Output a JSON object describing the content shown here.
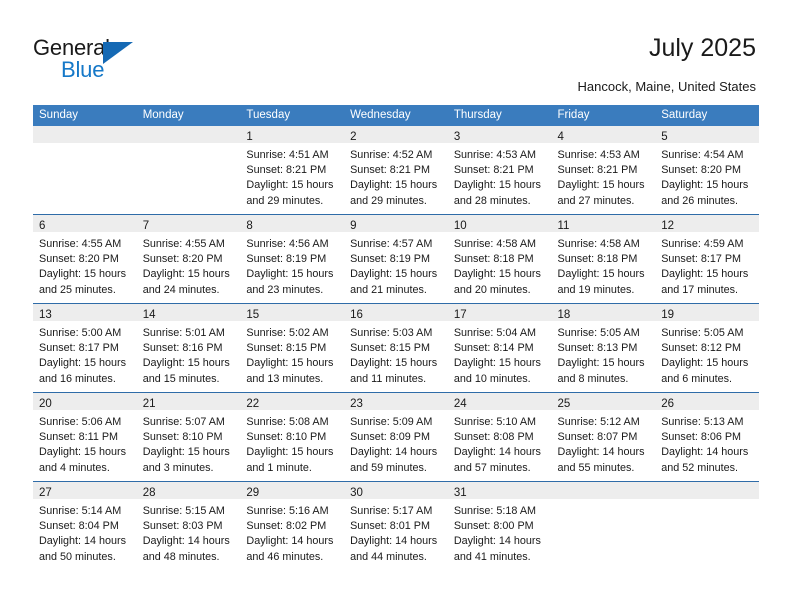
{
  "branding": {
    "name_part1": "General",
    "name_part2": "Blue"
  },
  "header": {
    "title": "July 2025",
    "location": "Hancock, Maine, United States"
  },
  "colors": {
    "header_blue": "#3a7cbe",
    "row_divider_blue": "#2f6ca8",
    "daynum_strip_gray": "#ededed",
    "logo_blue": "#1578c8"
  },
  "weekdays": [
    "Sunday",
    "Monday",
    "Tuesday",
    "Wednesday",
    "Thursday",
    "Friday",
    "Saturday"
  ],
  "weeks": [
    [
      {
        "day": "",
        "sunrise": "",
        "sunset": "",
        "daylight": "",
        "empty": true
      },
      {
        "day": "",
        "sunrise": "",
        "sunset": "",
        "daylight": "",
        "empty": true
      },
      {
        "day": "1",
        "sunrise": "Sunrise: 4:51 AM",
        "sunset": "Sunset: 8:21 PM",
        "daylight": "Daylight: 15 hours and 29 minutes."
      },
      {
        "day": "2",
        "sunrise": "Sunrise: 4:52 AM",
        "sunset": "Sunset: 8:21 PM",
        "daylight": "Daylight: 15 hours and 29 minutes."
      },
      {
        "day": "3",
        "sunrise": "Sunrise: 4:53 AM",
        "sunset": "Sunset: 8:21 PM",
        "daylight": "Daylight: 15 hours and 28 minutes."
      },
      {
        "day": "4",
        "sunrise": "Sunrise: 4:53 AM",
        "sunset": "Sunset: 8:21 PM",
        "daylight": "Daylight: 15 hours and 27 minutes."
      },
      {
        "day": "5",
        "sunrise": "Sunrise: 4:54 AM",
        "sunset": "Sunset: 8:20 PM",
        "daylight": "Daylight: 15 hours and 26 minutes."
      }
    ],
    [
      {
        "day": "6",
        "sunrise": "Sunrise: 4:55 AM",
        "sunset": "Sunset: 8:20 PM",
        "daylight": "Daylight: 15 hours and 25 minutes."
      },
      {
        "day": "7",
        "sunrise": "Sunrise: 4:55 AM",
        "sunset": "Sunset: 8:20 PM",
        "daylight": "Daylight: 15 hours and 24 minutes."
      },
      {
        "day": "8",
        "sunrise": "Sunrise: 4:56 AM",
        "sunset": "Sunset: 8:19 PM",
        "daylight": "Daylight: 15 hours and 23 minutes."
      },
      {
        "day": "9",
        "sunrise": "Sunrise: 4:57 AM",
        "sunset": "Sunset: 8:19 PM",
        "daylight": "Daylight: 15 hours and 21 minutes."
      },
      {
        "day": "10",
        "sunrise": "Sunrise: 4:58 AM",
        "sunset": "Sunset: 8:18 PM",
        "daylight": "Daylight: 15 hours and 20 minutes."
      },
      {
        "day": "11",
        "sunrise": "Sunrise: 4:58 AM",
        "sunset": "Sunset: 8:18 PM",
        "daylight": "Daylight: 15 hours and 19 minutes."
      },
      {
        "day": "12",
        "sunrise": "Sunrise: 4:59 AM",
        "sunset": "Sunset: 8:17 PM",
        "daylight": "Daylight: 15 hours and 17 minutes."
      }
    ],
    [
      {
        "day": "13",
        "sunrise": "Sunrise: 5:00 AM",
        "sunset": "Sunset: 8:17 PM",
        "daylight": "Daylight: 15 hours and 16 minutes."
      },
      {
        "day": "14",
        "sunrise": "Sunrise: 5:01 AM",
        "sunset": "Sunset: 8:16 PM",
        "daylight": "Daylight: 15 hours and 15 minutes."
      },
      {
        "day": "15",
        "sunrise": "Sunrise: 5:02 AM",
        "sunset": "Sunset: 8:15 PM",
        "daylight": "Daylight: 15 hours and 13 minutes."
      },
      {
        "day": "16",
        "sunrise": "Sunrise: 5:03 AM",
        "sunset": "Sunset: 8:15 PM",
        "daylight": "Daylight: 15 hours and 11 minutes."
      },
      {
        "day": "17",
        "sunrise": "Sunrise: 5:04 AM",
        "sunset": "Sunset: 8:14 PM",
        "daylight": "Daylight: 15 hours and 10 minutes."
      },
      {
        "day": "18",
        "sunrise": "Sunrise: 5:05 AM",
        "sunset": "Sunset: 8:13 PM",
        "daylight": "Daylight: 15 hours and 8 minutes."
      },
      {
        "day": "19",
        "sunrise": "Sunrise: 5:05 AM",
        "sunset": "Sunset: 8:12 PM",
        "daylight": "Daylight: 15 hours and 6 minutes."
      }
    ],
    [
      {
        "day": "20",
        "sunrise": "Sunrise: 5:06 AM",
        "sunset": "Sunset: 8:11 PM",
        "daylight": "Daylight: 15 hours and 4 minutes."
      },
      {
        "day": "21",
        "sunrise": "Sunrise: 5:07 AM",
        "sunset": "Sunset: 8:10 PM",
        "daylight": "Daylight: 15 hours and 3 minutes."
      },
      {
        "day": "22",
        "sunrise": "Sunrise: 5:08 AM",
        "sunset": "Sunset: 8:10 PM",
        "daylight": "Daylight: 15 hours and 1 minute."
      },
      {
        "day": "23",
        "sunrise": "Sunrise: 5:09 AM",
        "sunset": "Sunset: 8:09 PM",
        "daylight": "Daylight: 14 hours and 59 minutes."
      },
      {
        "day": "24",
        "sunrise": "Sunrise: 5:10 AM",
        "sunset": "Sunset: 8:08 PM",
        "daylight": "Daylight: 14 hours and 57 minutes."
      },
      {
        "day": "25",
        "sunrise": "Sunrise: 5:12 AM",
        "sunset": "Sunset: 8:07 PM",
        "daylight": "Daylight: 14 hours and 55 minutes."
      },
      {
        "day": "26",
        "sunrise": "Sunrise: 5:13 AM",
        "sunset": "Sunset: 8:06 PM",
        "daylight": "Daylight: 14 hours and 52 minutes."
      }
    ],
    [
      {
        "day": "27",
        "sunrise": "Sunrise: 5:14 AM",
        "sunset": "Sunset: 8:04 PM",
        "daylight": "Daylight: 14 hours and 50 minutes."
      },
      {
        "day": "28",
        "sunrise": "Sunrise: 5:15 AM",
        "sunset": "Sunset: 8:03 PM",
        "daylight": "Daylight: 14 hours and 48 minutes."
      },
      {
        "day": "29",
        "sunrise": "Sunrise: 5:16 AM",
        "sunset": "Sunset: 8:02 PM",
        "daylight": "Daylight: 14 hours and 46 minutes."
      },
      {
        "day": "30",
        "sunrise": "Sunrise: 5:17 AM",
        "sunset": "Sunset: 8:01 PM",
        "daylight": "Daylight: 14 hours and 44 minutes."
      },
      {
        "day": "31",
        "sunrise": "Sunrise: 5:18 AM",
        "sunset": "Sunset: 8:00 PM",
        "daylight": "Daylight: 14 hours and 41 minutes."
      },
      {
        "day": "",
        "sunrise": "",
        "sunset": "",
        "daylight": "",
        "empty": true
      },
      {
        "day": "",
        "sunrise": "",
        "sunset": "",
        "daylight": "",
        "empty": true
      }
    ]
  ]
}
